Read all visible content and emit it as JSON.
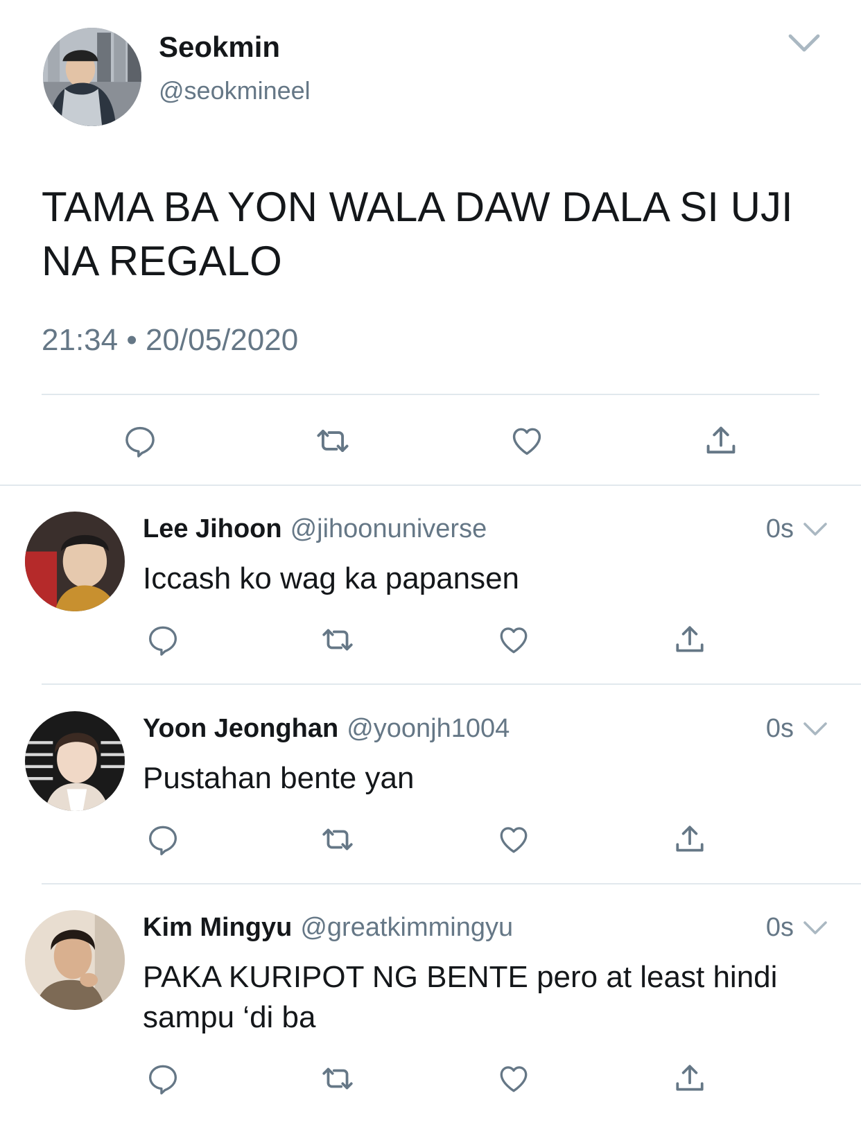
{
  "main_tweet": {
    "display_name": "Seokmin",
    "handle": "@seokmineel",
    "text_line1": "TAMA BA YON WALA DAW DALA SI UJI",
    "text_line2": "NA REGALO",
    "timestamp": "21:34 • 20/05/2020"
  },
  "replies": [
    {
      "display_name": "Lee Jihoon",
      "handle": "@jihoonuniverse",
      "time": "0s",
      "text_line1": "Iccash ko wag ka papansen",
      "text_line2": ""
    },
    {
      "display_name": "Yoon Jeonghan",
      "handle": "@yoonjh1004",
      "time": "0s",
      "text_line1": "Pustahan bente yan",
      "text_line2": ""
    },
    {
      "display_name": "Kim Mingyu",
      "handle": "@greatkimmingyu",
      "time": "0s",
      "text_line1": "PAKA KURIPOT NG BENTE pero at least hindi",
      "text_line2": "sampu ‘di ba"
    }
  ],
  "icons": [
    "chevron-down-icon",
    "reply-icon",
    "retweet-icon",
    "like-icon",
    "share-icon"
  ],
  "colors": {
    "text": "#14171a",
    "secondary": "#657786",
    "icon": "#657786",
    "divider": "#e1e8ed"
  }
}
